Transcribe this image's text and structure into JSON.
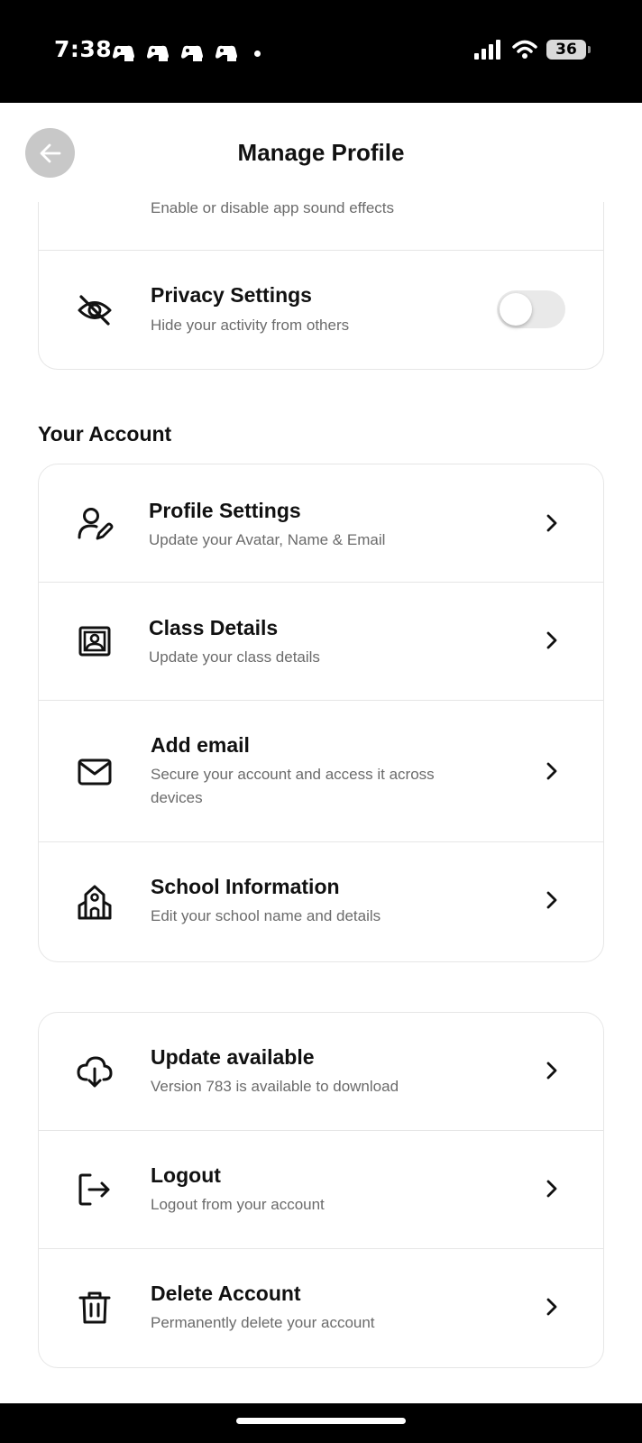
{
  "status_bar": {
    "time": "7:38",
    "battery": "36"
  },
  "header": {
    "title": "Manage Profile"
  },
  "preferences": {
    "sound_effects_sub": "Enable or disable app sound effects",
    "privacy_title": "Privacy Settings",
    "privacy_sub": "Hide your activity from others"
  },
  "account_section": {
    "title": "Your Account",
    "items": [
      {
        "title": "Profile Settings",
        "sub": "Update your Avatar, Name & Email"
      },
      {
        "title": "Class Details",
        "sub": "Update your class details"
      },
      {
        "title": "Add email",
        "sub": "Secure your account and access it across devices"
      },
      {
        "title": "School Information",
        "sub": "Edit your school name and details"
      }
    ]
  },
  "other_section": {
    "items": [
      {
        "title": "Update available",
        "sub": "Version 783 is available to download"
      },
      {
        "title": "Logout",
        "sub": "Logout from your account"
      },
      {
        "title": "Delete Account",
        "sub": "Permanently delete your account"
      }
    ]
  },
  "colors": {
    "toggle_on": "#2358d8",
    "toggle_off": "#e9e9e9",
    "back_button": "#c8c8c8"
  }
}
